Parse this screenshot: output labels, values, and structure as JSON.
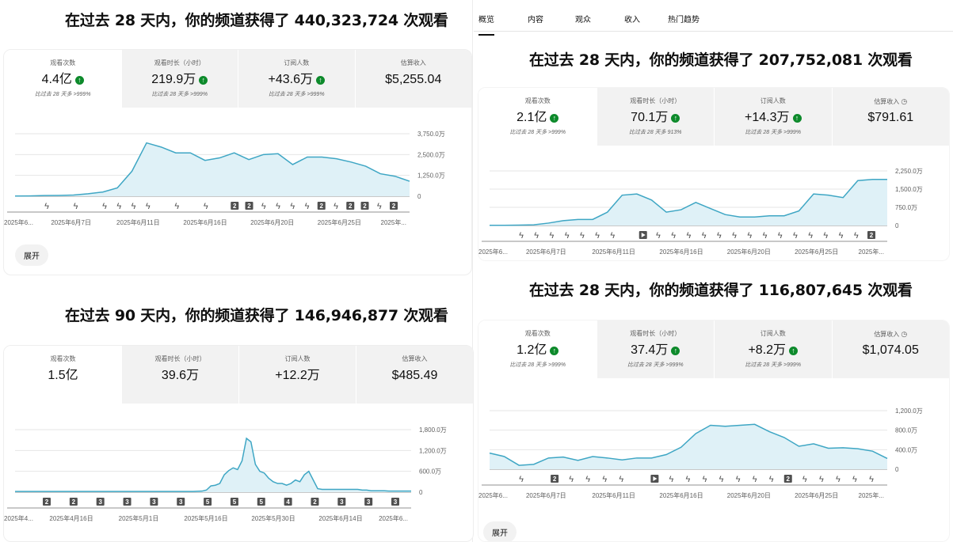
{
  "tabs": [
    {
      "label": "概览"
    },
    {
      "label": "内容"
    },
    {
      "label": "观众"
    },
    {
      "label": "收入"
    },
    {
      "label": "热门趋势"
    }
  ],
  "panels": [
    {
      "headline": "在过去 28 天内，你的频道获得了 440,323,724 次观看",
      "metrics": [
        {
          "label": "观看次数",
          "value": "4.4亿",
          "up": true,
          "compare": "比过去 28 天多 >999%"
        },
        {
          "label": "观看时长（小时）",
          "value": "219.9万",
          "up": true,
          "compare": "比过去 28 天多 >999%"
        },
        {
          "label": "订阅人数",
          "value": "+43.6万",
          "up": true,
          "compare": "比过去 28 天多 >999%"
        },
        {
          "label": "估算收入",
          "value": "$5,255.04",
          "up": false,
          "compare": ""
        }
      ],
      "expand_label": "展开"
    },
    {
      "headline": "在过去 90 天内，你的频道获得了 146,946,877 次观看",
      "metrics": [
        {
          "label": "观看次数",
          "value": "1.5亿",
          "up": false,
          "compare": ""
        },
        {
          "label": "观看时长（小时）",
          "value": "39.6万",
          "up": false,
          "compare": ""
        },
        {
          "label": "订阅人数",
          "value": "+12.2万",
          "up": false,
          "compare": ""
        },
        {
          "label": "估算收入",
          "value": "$485.49",
          "up": false,
          "compare": ""
        }
      ]
    },
    {
      "headline": "在过去 28 天内，你的频道获得了 207,752,081 次观看",
      "metrics": [
        {
          "label": "观看次数",
          "value": "2.1亿",
          "up": true,
          "compare": "比过去 28 天多 >999%"
        },
        {
          "label": "观看时长（小时）",
          "value": "70.1万",
          "up": true,
          "compare": "比过去 28 天多 913%"
        },
        {
          "label": "订阅人数",
          "value": "+14.3万",
          "up": true,
          "compare": "比过去 28 天多 >999%"
        },
        {
          "label": "估算收入",
          "value": "$791.61",
          "up": false,
          "clock": true,
          "compare": ""
        }
      ]
    },
    {
      "headline": "在过去 28 天内，你的频道获得了 116,807,645 次观看",
      "metrics": [
        {
          "label": "观看次数",
          "value": "1.2亿",
          "up": true,
          "compare": "比过去 28 天多 >999%"
        },
        {
          "label": "观看时长（小时）",
          "value": "37.4万",
          "up": true,
          "compare": "比过去 28 天多 >999%"
        },
        {
          "label": "订阅人数",
          "value": "+8.2万",
          "up": true,
          "compare": "比过去 28 天多 >999%"
        },
        {
          "label": "估算收入",
          "value": "$1,074.05",
          "up": false,
          "clock": true,
          "compare": ""
        }
      ],
      "expand_label": "展开"
    }
  ],
  "colors": {
    "line": "#3ea6c4",
    "fill": "#dff1f7",
    "up": "#0d8a2b"
  },
  "chart_data": [
    {
      "type": "area",
      "x_ticks": [
        "2025年6...",
        "2025年6月7日",
        "2025年6月11日",
        "2025年6月16日",
        "2025年6月20日",
        "2025年6月25日",
        "2025年..."
      ],
      "y_ticks": [
        "3,750.0万",
        "2,500.0万",
        "1,250.0万",
        "0"
      ],
      "ylim": [
        0,
        3750
      ],
      "values": [
        10,
        20,
        40,
        50,
        70,
        150,
        250,
        500,
        1500,
        3200,
        2950,
        2600,
        2600,
        2150,
        2300,
        2600,
        2200,
        2500,
        2550,
        1900,
        2350,
        2350,
        2250,
        2050,
        1800,
        1350,
        1200,
        900
      ],
      "markers": [
        "s",
        "",
        "s",
        "",
        "s",
        "s",
        "s",
        "s",
        "",
        "s",
        "",
        "s",
        "",
        "2",
        "2",
        "s",
        "s",
        "s",
        "s",
        "2",
        "s",
        "2",
        "2",
        "s",
        "2"
      ]
    },
    {
      "type": "area",
      "x_ticks": [
        "2025年4...",
        "2025年4月16日",
        "2025年5月1日",
        "2025年5月16日",
        "2025年5月30日",
        "2025年6月14日",
        "2025年6..."
      ],
      "y_ticks": [
        "1,800.0万",
        "1,200.0万",
        "600.0万",
        "0"
      ],
      "ylim": [
        0,
        1800
      ],
      "values": [
        20,
        20,
        20,
        20,
        20,
        20,
        20,
        20,
        20,
        20,
        20,
        20,
        20,
        20,
        20,
        20,
        20,
        20,
        20,
        20,
        20,
        20,
        20,
        20,
        20,
        20,
        20,
        20,
        20,
        20,
        20,
        20,
        20,
        20,
        20,
        20,
        20,
        20,
        20,
        20,
        20,
        25,
        30,
        60,
        180,
        200,
        250,
        500,
        620,
        700,
        650,
        900,
        1550,
        1450,
        800,
        600,
        550,
        400,
        300,
        250,
        250,
        200,
        250,
        350,
        300,
        500,
        600,
        350,
        100,
        80,
        80,
        80,
        80,
        80,
        80,
        80,
        80,
        80,
        60,
        60,
        40,
        40,
        40,
        40,
        30,
        30,
        30,
        30,
        30,
        30
      ],
      "markers": [
        "2",
        "2",
        "3",
        "3",
        "3",
        "3",
        "5",
        "5",
        "5",
        "4",
        "2",
        "3",
        "3",
        "3"
      ]
    },
    {
      "type": "area",
      "x_ticks": [
        "2025年6...",
        "2025年6月7日",
        "2025年6月11日",
        "2025年6月16日",
        "2025年6月20日",
        "2025年6月25日",
        "2025年..."
      ],
      "y_ticks": [
        "2,250.0万",
        "1,500.0万",
        "750.0万",
        "0"
      ],
      "ylim": [
        0,
        2250
      ],
      "values": [
        10,
        10,
        15,
        30,
        100,
        200,
        250,
        250,
        550,
        1250,
        1300,
        1050,
        550,
        650,
        950,
        700,
        450,
        350,
        350,
        400,
        400,
        600,
        1300,
        1250,
        1150,
        1850,
        1900,
        1900
      ],
      "markers": [
        "s",
        "s",
        "s",
        "s",
        "s",
        "s",
        "s",
        "",
        "p",
        "s",
        "s",
        "s",
        "s",
        "s",
        "s",
        "s",
        "s",
        "s",
        "s",
        "s",
        "s",
        "s",
        "s",
        "2"
      ]
    },
    {
      "type": "area",
      "x_ticks": [
        "2025年6...",
        "2025年6月7日",
        "2025年6月11日",
        "2025年6月16日",
        "2025年6月20日",
        "2025年6月25日",
        "2025年..."
      ],
      "y_ticks": [
        "1,200.0万",
        "800.0万",
        "400.0万",
        "0"
      ],
      "ylim": [
        0,
        1200
      ],
      "values": [
        330,
        260,
        80,
        100,
        230,
        250,
        180,
        260,
        230,
        190,
        230,
        230,
        300,
        450,
        730,
        900,
        880,
        900,
        920,
        770,
        650,
        470,
        520,
        430,
        440,
        420,
        370,
        220
      ],
      "markers": [
        "s",
        "",
        "2",
        "s",
        "s",
        "s",
        "s",
        "",
        "p",
        "s",
        "s",
        "s",
        "s",
        "s",
        "s",
        "s",
        "2",
        "s",
        "s",
        "s",
        "s",
        "s"
      ]
    }
  ]
}
